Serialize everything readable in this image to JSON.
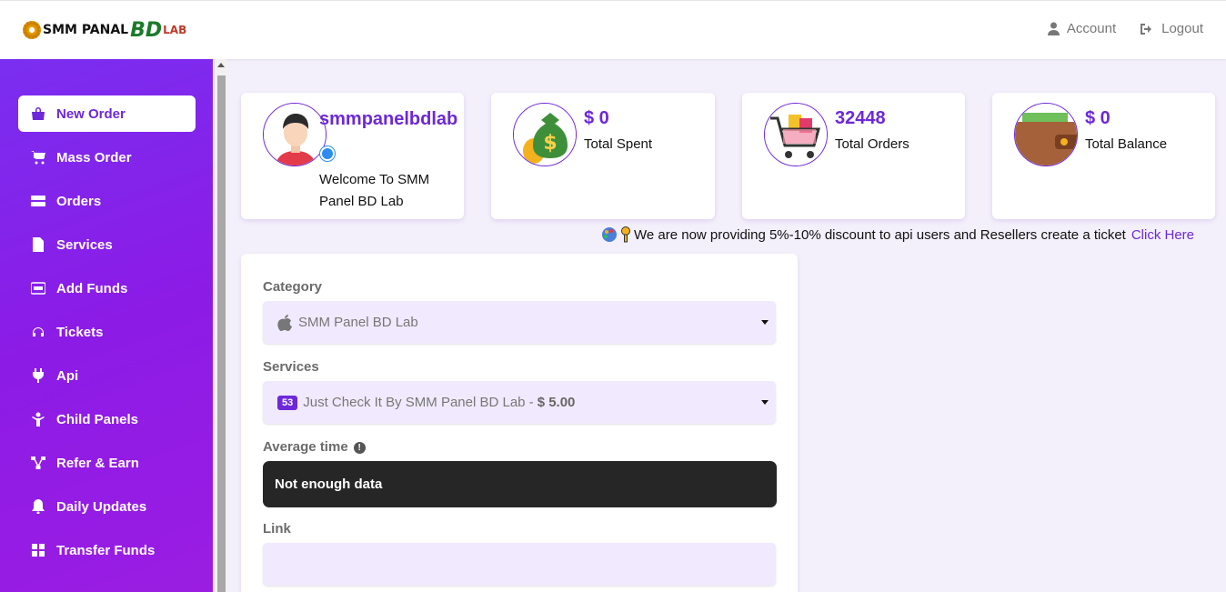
{
  "header": {
    "logo_text_1": "SMM PANAL",
    "logo_text_2": "BD",
    "logo_text_3": "LAB",
    "account_label": "Account",
    "logout_label": "Logout"
  },
  "sidebar": {
    "items": [
      {
        "label": "New Order",
        "icon": "shopping-bag-icon",
        "active": true
      },
      {
        "label": "Mass Order",
        "icon": "cart-plus-icon"
      },
      {
        "label": "Orders",
        "icon": "server-icon"
      },
      {
        "label": "Services",
        "icon": "file-icon"
      },
      {
        "label": "Add Funds",
        "icon": "pay-icon"
      },
      {
        "label": "Tickets",
        "icon": "headset-icon"
      },
      {
        "label": "Api",
        "icon": "plug-icon"
      },
      {
        "label": "Child Panels",
        "icon": "child-icon"
      },
      {
        "label": "Refer & Earn",
        "icon": "network-icon"
      },
      {
        "label": "Daily Updates",
        "icon": "bell-icon"
      },
      {
        "label": "Transfer Funds",
        "icon": "grid-icon"
      }
    ]
  },
  "profile": {
    "username": "smmpanelbdlab",
    "welcome": "Welcome To SMM Panel BD Lab"
  },
  "stats": {
    "spent_value": "$ 0",
    "spent_label": "Total Spent",
    "orders_value": "32448",
    "orders_label": "Total Orders",
    "balance_value": "$ 0",
    "balance_label": "Total Balance"
  },
  "notice": {
    "text": "We are now providing 5%-10% discount to api users and Resellers create a ticket",
    "link": "Click Here"
  },
  "form": {
    "category_label": "Category",
    "category_value": "SMM Panel BD Lab",
    "services_label": "Services",
    "service_id": "53",
    "service_name": "Just Check It By SMM Panel BD Lab -",
    "service_price": "$ 5.00",
    "avg_time_label": "Average time",
    "avg_time_value": "Not enough data",
    "link_label": "Link",
    "link_value": ""
  },
  "colors": {
    "accent": "#6d28d9",
    "sidebar_gradient_start": "#7a2ef0",
    "sidebar_gradient_end": "#9b1de2",
    "input_bg": "#f1e9fd"
  }
}
